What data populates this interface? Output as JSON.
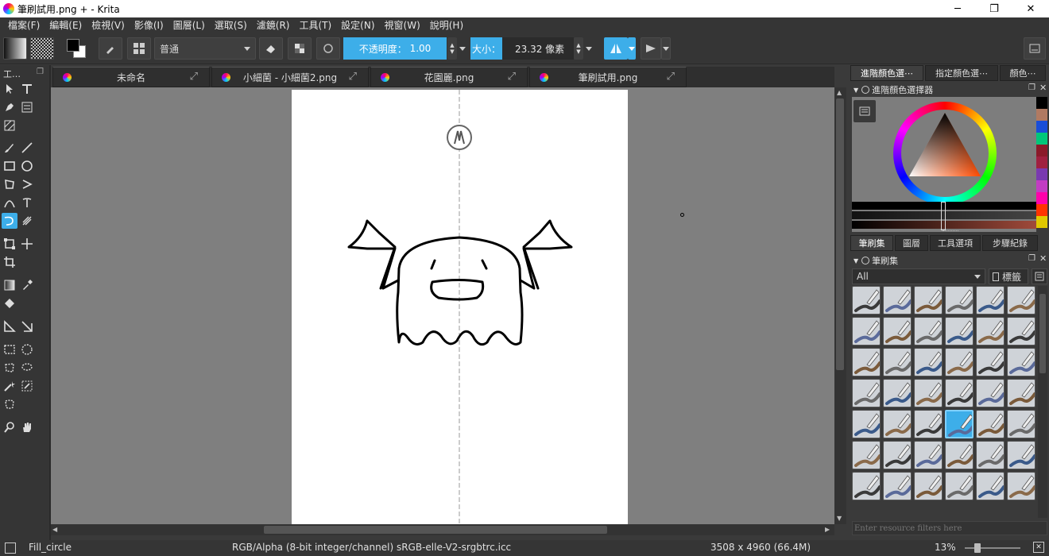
{
  "window": {
    "title": "筆刷試用.png + - Krita",
    "min_label": "─",
    "max_label": "❐",
    "close_label": "✕"
  },
  "menu": [
    "檔案(F)",
    "編輯(E)",
    "檢視(V)",
    "影像(I)",
    "圖層(L)",
    "選取(S)",
    "濾鏡(R)",
    "工具(T)",
    "設定(N)",
    "視窗(W)",
    "說明(H)"
  ],
  "toolbar": {
    "blend_mode": "普通",
    "opacity_label": "不透明度：",
    "opacity_value": "1.00",
    "size_label": "大小：",
    "size_value": "23.32 像素"
  },
  "tabs": [
    {
      "label": "未命名"
    },
    {
      "label": "小細菌 - 小細菌2.png"
    },
    {
      "label": "花園麗.png"
    },
    {
      "label": "筆刷試用.png"
    }
  ],
  "toolbox": {
    "title": "工…"
  },
  "right_top_tabs": [
    "進階顏色選⋯",
    "指定顏色選⋯",
    "顏色⋯"
  ],
  "color_docker": {
    "title": "進階顏色選擇器",
    "swatches": [
      "#000000",
      "#b07a62",
      "#1a4ed8",
      "#00c77a",
      "#8b1a2a",
      "#a02040",
      "#7a3ab0",
      "#c23cc2",
      "#ff00aa",
      "#ff3300",
      "#e0c800"
    ]
  },
  "right_bottom_tabs": [
    "筆刷集",
    "圖層",
    "工具選項",
    "步驟紀錄"
  ],
  "brush_docker": {
    "title": "筆刷集",
    "filter_value": "All",
    "tag_label": "標籤",
    "search_placeholder": "Enter resource filters here"
  },
  "status": {
    "brush_name": "Fill_circle",
    "color_space": "RGB/Alpha (8-bit integer/channel)  sRGB-elle-V2-srgbtrc.icc",
    "dimensions": "3508 x 4960 (66.4M)",
    "zoom": "13%"
  }
}
